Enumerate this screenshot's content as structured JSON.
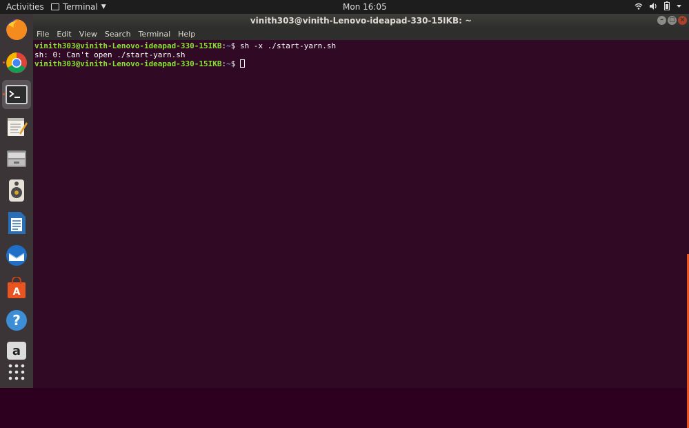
{
  "topbar": {
    "activities": "Activities",
    "app_menu": "Terminal",
    "clock": "Mon 16:05",
    "tray_icons": [
      "wifi-icon",
      "volume-icon",
      "battery-icon",
      "system-menu-icon"
    ]
  },
  "dock": {
    "items": [
      "firefox",
      "chrome",
      "terminal",
      "text-editor",
      "files",
      "rhythmbox",
      "libreoffice-writer",
      "thunderbird",
      "software-center",
      "help",
      "amazon",
      "show-applications"
    ],
    "active": "terminal"
  },
  "window": {
    "title": "vinith303@vinith-Lenovo-ideapad-330-15IKB: ~",
    "menu": [
      "File",
      "Edit",
      "View",
      "Search",
      "Terminal",
      "Help"
    ]
  },
  "terminal": {
    "prompt_user": "vinith303@vinith-Lenovo-ideapad-330-15IKB",
    "prompt_path": "~",
    "prompt_sep": ":",
    "prompt_end": "$ ",
    "command1": "sh -x ./start-yarn.sh",
    "output1": "sh: 0: Can't open ./start-yarn.sh"
  },
  "colors": {
    "terminal_bg": "#300a24",
    "prompt_user": "#8ae234",
    "prompt_path": "#729fcf",
    "accent": "#e95420"
  }
}
